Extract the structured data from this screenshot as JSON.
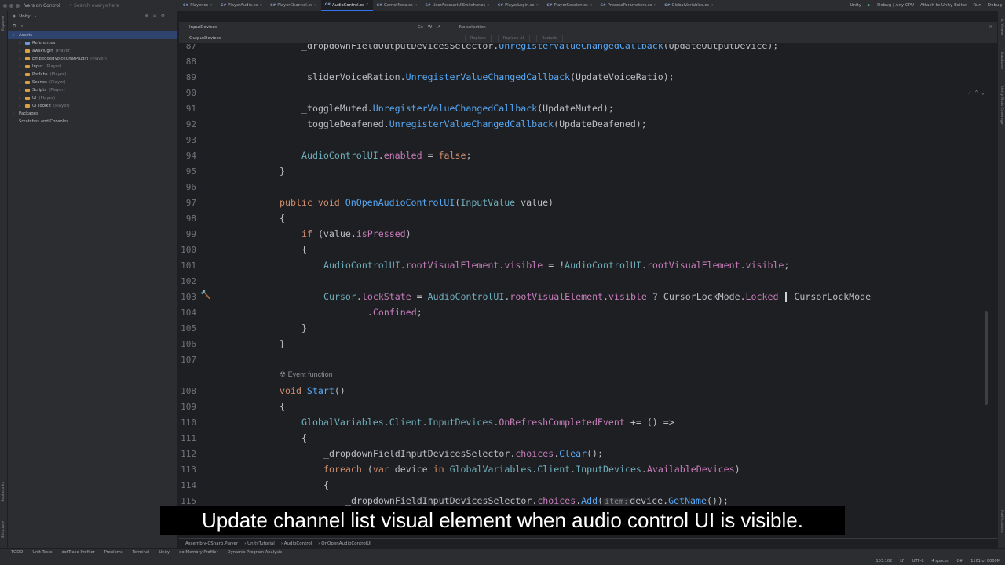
{
  "titlebar": {
    "version_control": "Version Control",
    "search_placeholder": "Search everywhere",
    "tabs": [
      {
        "label": "Player.cs"
      },
      {
        "label": "PlayerAudio.cs"
      },
      {
        "label": "PlayerChannel.cs"
      },
      {
        "label": "AudioControl.cs"
      },
      {
        "label": "GameMode.cs"
      },
      {
        "label": "UserAccountUISwitcher.cs"
      },
      {
        "label": "PlayerLogin.cs"
      },
      {
        "label": "PlayerSession.cs"
      },
      {
        "label": "ProcessParameters.cs"
      },
      {
        "label": "GlobalVariables.cs"
      }
    ],
    "active_tab_index": 3,
    "unity_label": "Unity",
    "config": "Debug | Any CPU",
    "attach": "Attach to Unity Editor",
    "run": "Run",
    "debug": "Debug"
  },
  "project": {
    "title": "Unity",
    "tree": [
      {
        "label": "Assets",
        "meta": "",
        "indent": 0,
        "arrow": "▾",
        "folder": "none",
        "selected": true
      },
      {
        "label": "References",
        "meta": "",
        "indent": 1,
        "arrow": "›",
        "folder": "blue",
        "selected": false
      },
      {
        "label": "awsPlugin",
        "meta": "(Player)",
        "indent": 1,
        "arrow": "›",
        "folder": "yellow",
        "selected": false
      },
      {
        "label": "EmbeddedVoiceChatPlugin",
        "meta": "(Player)",
        "indent": 1,
        "arrow": "›",
        "folder": "yellow",
        "selected": false
      },
      {
        "label": "Input",
        "meta": "(Player)",
        "indent": 1,
        "arrow": "›",
        "folder": "yellow",
        "selected": false
      },
      {
        "label": "Prefabs",
        "meta": "(Player)",
        "indent": 1,
        "arrow": "›",
        "folder": "yellow",
        "selected": false
      },
      {
        "label": "Scenes",
        "meta": "(Player)",
        "indent": 1,
        "arrow": "›",
        "folder": "yellow",
        "selected": false
      },
      {
        "label": "Scripts",
        "meta": "(Player)",
        "indent": 1,
        "arrow": "›",
        "folder": "yellow",
        "selected": false
      },
      {
        "label": "UI",
        "meta": "(Player)",
        "indent": 1,
        "arrow": "›",
        "folder": "yellow",
        "selected": false
      },
      {
        "label": "UI Toolkit",
        "meta": "(Player)",
        "indent": 1,
        "arrow": "›",
        "folder": "yellow",
        "selected": false
      },
      {
        "label": "Packages",
        "meta": "",
        "indent": 0,
        "arrow": "›",
        "folder": "none",
        "selected": false
      },
      {
        "label": "Scratches and Consoles",
        "meta": "",
        "indent": 0,
        "arrow": "",
        "folder": "none",
        "selected": false
      }
    ]
  },
  "find": {
    "search_value": "InputDevices",
    "replace_value": "OutputDevices",
    "opt_case": "Cc",
    "opt_word": "W",
    "opt_regex": ".*",
    "no_selection": "No selection",
    "replace_btn": "Replace",
    "replace_all_btn": "Replace All",
    "exclude_btn": "Exclude"
  },
  "editor": {
    "lens": "Event function",
    "lines": [
      {
        "n": "87",
        "html": "<span class='s'>_dropdownFieldOutputDevicesSelector.</span><span class='f'>UnregisterValueChangedCallback</span>(<span class='s'>UpdateOutputDevice</span>);"
      },
      {
        "n": "88",
        "html": ""
      },
      {
        "n": "89",
        "html": "<span class='s'>_sliderVoiceRation.</span><span class='f'>UnregisterValueChangedCallback</span>(UpdateVoiceRatio);"
      },
      {
        "n": "90",
        "html": ""
      },
      {
        "n": "91",
        "html": "_toggleMuted.<span class='f'>UnregisterValueChangedCallback</span>(UpdateMuted);"
      },
      {
        "n": "92",
        "html": "_toggleDeafened.<span class='f'>UnregisterValueChangedCallback</span>(UpdateDeafened);"
      },
      {
        "n": "93",
        "html": ""
      },
      {
        "n": "94",
        "html": "<span class='t'>AudioControlUI</span>.<span class='m'>enabled</span> = <span class='k'>false</span>;"
      },
      {
        "n": "95",
        "html": "}"
      },
      {
        "n": "96",
        "html": ""
      },
      {
        "n": "97",
        "html": "<span class='k'>public void</span> <span class='f'>OnOpenAudioControlUI</span>(<span class='t'>InputValue</span> value)"
      },
      {
        "n": "98",
        "html": "{"
      },
      {
        "n": "99",
        "html": "<span class='k'>if</span> (value.<span class='m'>isPressed</span>)"
      },
      {
        "n": "100",
        "html": "{"
      },
      {
        "n": "101",
        "html": "<span class='t'>AudioControlUI</span>.<span class='m'>rootVisualElement</span>.<span class='m'>visible</span> = !<span class='t'>AudioControlUI</span>.<span class='m'>rootVisualElement</span>.<span class='m'>visible</span>;"
      },
      {
        "n": "102",
        "html": ""
      },
      {
        "n": "103",
        "html": "<span class='t'>Cursor</span>.<span class='m'>lockState</span> = <span class='t'>AudioControlUI</span>.<span class='m'>rootVisualElement</span>.<span class='m'>visible</span> ? CursorLockMode.<span class='m'>Locked</span> <span class='caret'></span> CursorLockMode"
      },
      {
        "n": "104",
        "html": "    .<span class='m'>Confined</span>;"
      },
      {
        "n": "105",
        "html": "}"
      },
      {
        "n": "106",
        "html": "}"
      },
      {
        "n": "107",
        "html": ""
      },
      {
        "n": "108",
        "html": "<span class='k'>void</span> <span class='f'>Start</span>()"
      },
      {
        "n": "109",
        "html": "{"
      },
      {
        "n": "110",
        "html": "<span class='t'>GlobalVariables</span>.<span class='t'>Client</span>.<span class='t'>InputDevices</span>.<span class='m'>OnRefreshCompletedEvent</span> += () =>"
      },
      {
        "n": "111",
        "html": "{"
      },
      {
        "n": "112",
        "html": "_dropdownFieldInputDevicesSelector.<span class='m'>choices</span>.<span class='f'>Clear</span>();"
      },
      {
        "n": "113",
        "html": "<span class='k'>foreach</span> (<span class='k'>var</span> device <span class='k'>in</span> <span class='t'>GlobalVariables</span>.<span class='t'>Client</span>.<span class='t'>InputDevices</span>.<span class='m'>AvailableDevices</span>)"
      },
      {
        "n": "114",
        "html": "{"
      },
      {
        "n": "115",
        "html": "_dropdownFieldInputDevicesSelector.<span class='m'>choices</span>.<span class='f'>Add</span>(<span class='hint'>item:</span>device.<span class='f'>GetName</span>());"
      }
    ]
  },
  "crumbs": [
    "Assembly-CSharp.Player",
    "UnityTutorial",
    "AudioControl",
    "OnOpenAudioControlUI"
  ],
  "bottom_tools": [
    "TODO",
    "Unit Tests",
    "dotTrace Profiler",
    "Problems",
    "Terminal",
    "Unity",
    "dotMemory Profiler",
    "Dynamic Program Analysis"
  ],
  "status": [
    "103:102",
    "LF",
    "UTF-8",
    "4 spaces",
    "C#",
    "1101 of 8000M"
  ],
  "subtitle": "Update channel list visual element when audio control UI is visible.",
  "side": {
    "left_top": "Explorer",
    "left_bottom": [
      "Bookmarks",
      "Structure"
    ],
    "right": [
      "IL Viewer",
      "Database",
      "Unity Tests Coverage",
      "Notifications"
    ]
  }
}
